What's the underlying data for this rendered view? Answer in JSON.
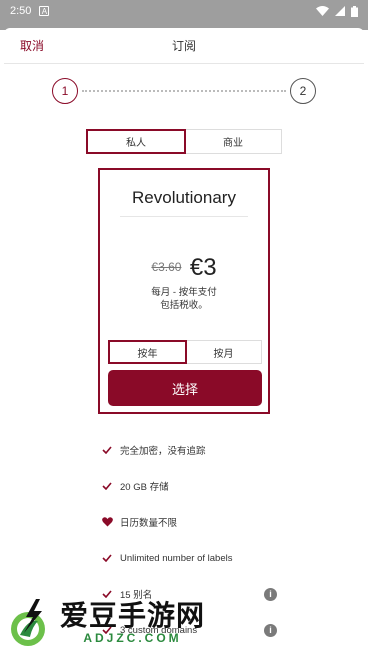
{
  "status": {
    "time": "2:50",
    "notification_icon": "A"
  },
  "header": {
    "cancel_label": "取消",
    "title": "订阅"
  },
  "stepper": {
    "step1": "1",
    "step2": "2",
    "current": 1
  },
  "account_type": {
    "options": [
      "私人",
      "商业"
    ],
    "selected": "私人"
  },
  "plan": {
    "name": "Revolutionary",
    "old_price": "€3.60",
    "price": "€3",
    "period_line1": "每月 - 按年支付",
    "period_line2": "包括税收。",
    "billing_options": [
      "按年",
      "按月"
    ],
    "billing_selected": "按年",
    "choose_label": "选择"
  },
  "features": [
    {
      "icon": "check-icon",
      "text": "完全加密，没有追踪",
      "info": false
    },
    {
      "icon": "check-icon",
      "text": "20 GB 存储",
      "info": false
    },
    {
      "icon": "heart-icon",
      "text": "日历数量不限",
      "info": false
    },
    {
      "icon": "check-icon",
      "text": "Unlimited number of labels",
      "info": false
    },
    {
      "icon": "check-icon",
      "text": "15 别名",
      "info": true
    },
    {
      "icon": "check-icon",
      "text": "3 custom domains",
      "info": true
    }
  ],
  "watermark": {
    "title": "爱豆手游网",
    "url": "ADJZC.COM"
  },
  "colors": {
    "accent": "#8a0a28",
    "status_bar": "#9e9e9e"
  }
}
